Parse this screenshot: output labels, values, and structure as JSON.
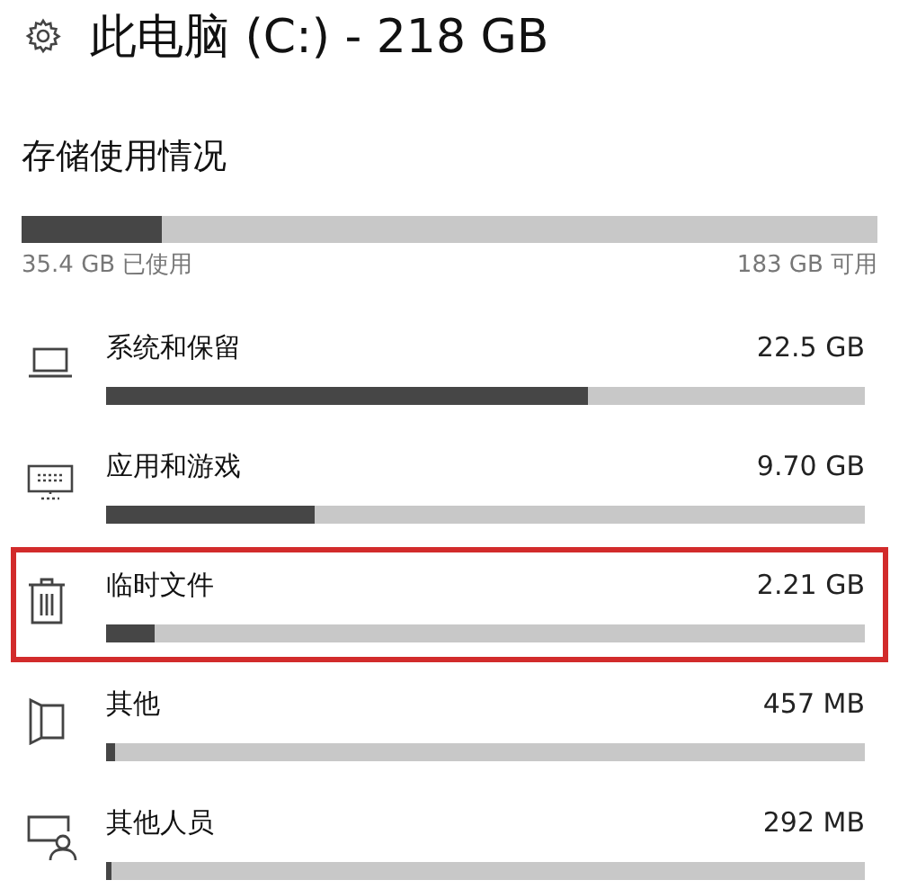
{
  "header": {
    "title": "此电脑 (C:) - 218 GB"
  },
  "usage": {
    "heading": "存储使用情况",
    "level": 0.164,
    "used": "35.4 GB 已使用",
    "free": "183 GB 可用"
  },
  "categories": [
    {
      "kind": "laptop",
      "name": "系统和保留",
      "size": "22.5 GB",
      "level": 0.636,
      "highlighted": false
    },
    {
      "kind": "apps",
      "name": "应用和游戏",
      "size": "9.70 GB",
      "level": 0.274,
      "highlighted": false
    },
    {
      "kind": "trash",
      "name": "临时文件",
      "size": "2.21 GB",
      "level": 0.064,
      "highlighted": true
    },
    {
      "kind": "document",
      "name": "其他",
      "size": "457 MB",
      "level": 0.012,
      "highlighted": false
    },
    {
      "kind": "people",
      "name": "其他人员",
      "size": "292 MB",
      "level": 0.008,
      "highlighted": false
    }
  ]
}
